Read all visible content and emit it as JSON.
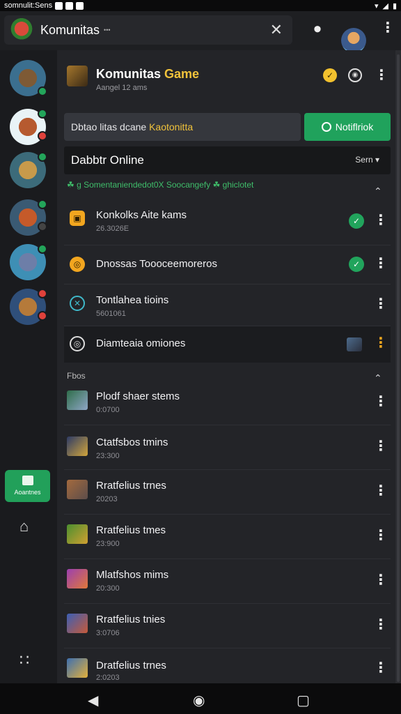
{
  "status_bar": {
    "left_text": "somnulit:Sens"
  },
  "top_bar": {
    "search_title": "Komunitas",
    "search_sub": "•••",
    "close_glyph": "✕"
  },
  "header": {
    "title_main": "Komunitas ",
    "title_highlight": "Game",
    "subtitle": "Aangel 12 ams"
  },
  "notice": {
    "text_main": "Dbtao litas dcane ",
    "text_highlight": "Kaotonitta",
    "button_label": "Notiflriok"
  },
  "online_bar": {
    "title": "Dabbtr Online",
    "sort_label": "Sern ▾"
  },
  "tagline": "☘ g Somentaniendedot0X Soocangefy ☘ ghiclotet",
  "channels": [
    {
      "title": "Konkolks Aite kams",
      "sub": "26.3026E",
      "icon": "▣",
      "checked": true
    },
    {
      "title": "Dnossas Toooceemoreros",
      "sub": "",
      "icon": "◎",
      "checked": true
    },
    {
      "title": "Tontlahea tioins",
      "sub": "5601061",
      "icon": "✕",
      "checked": false
    },
    {
      "title": "Diamteaia omiones",
      "sub": "",
      "icon": "◎",
      "checked": false
    }
  ],
  "section_label": "Fbos",
  "games": [
    {
      "title": "Plodf shaer stems",
      "sub": "0:0700"
    },
    {
      "title": "Ctatfsbos tmins",
      "sub": "23:300"
    },
    {
      "title": "Rratfelius trnes",
      "sub": "20203"
    },
    {
      "title": "Rratfelius tmes",
      "sub": "23:900"
    },
    {
      "title": "Mlatfshos mims",
      "sub": "20:300"
    },
    {
      "title": "Rratfelius tnies",
      "sub": "3:0706"
    },
    {
      "title": "Dratfelius trnes",
      "sub": "2:0203"
    }
  ],
  "rail": {
    "button_label": "Aoantnes"
  },
  "colors": {
    "accent_green": "#20a25c",
    "highlight_yellow": "#f0c23b",
    "bg": "#232428"
  }
}
